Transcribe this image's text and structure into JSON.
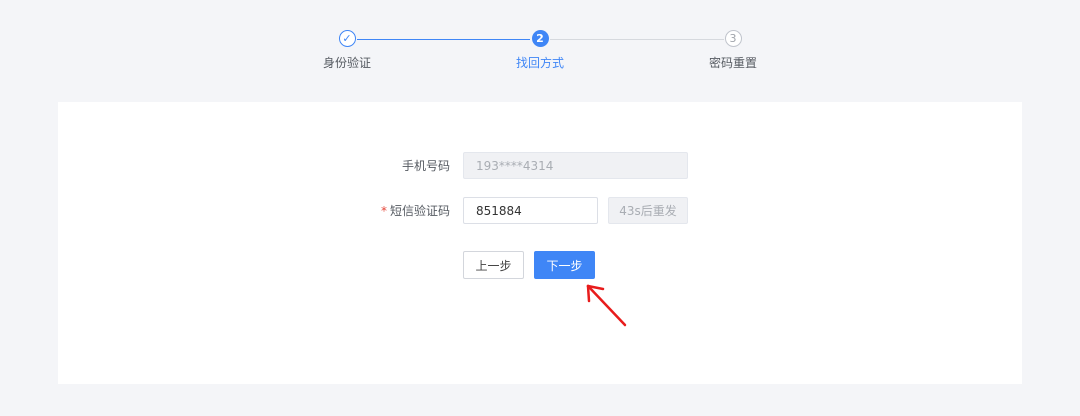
{
  "steps": [
    {
      "label": "身份验证",
      "state": "done",
      "marker": "✓"
    },
    {
      "label": "找回方式",
      "state": "active",
      "marker": "2"
    },
    {
      "label": "密码重置",
      "state": "todo",
      "marker": "3"
    }
  ],
  "form": {
    "phone": {
      "label": "手机号码",
      "value": "193****4314"
    },
    "sms_code": {
      "label": "短信验证码",
      "required_mark": "*",
      "value": "851884",
      "resend_label": "43s后重发"
    }
  },
  "actions": {
    "prev_label": "上一步",
    "next_label": "下一步"
  },
  "colors": {
    "primary": "#3f86f6",
    "annotation_arrow": "#e81c1c",
    "required": "#e5483b"
  }
}
